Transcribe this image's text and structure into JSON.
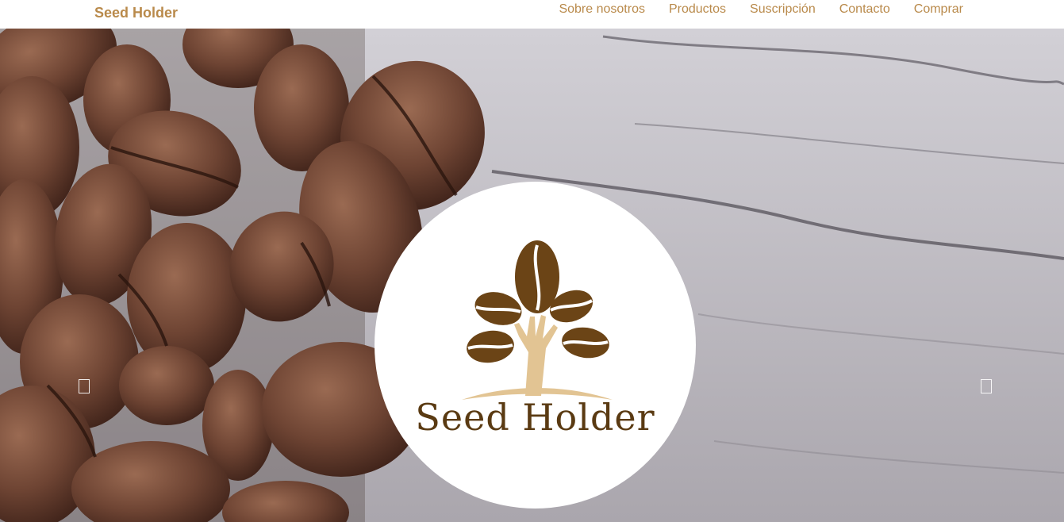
{
  "navbar": {
    "brand": "Seed Holder",
    "links": [
      "Sobre nosotros",
      "Productos",
      "Suscripción",
      "Contacto",
      "Comprar"
    ]
  },
  "hero": {
    "logo_text": "Seed Holder",
    "logo_icon": "coffee-tree-hand-icon",
    "background": "coffee-beans-on-wood-photo",
    "prev_icon": "carousel-prev-icon",
    "next_icon": "carousel-next-icon"
  },
  "colors": {
    "nav_text": "#b98a4b",
    "logo_brown": "#6b4416",
    "logo_sand": "#e2c493",
    "hero_gray": "#bdb9c0"
  }
}
